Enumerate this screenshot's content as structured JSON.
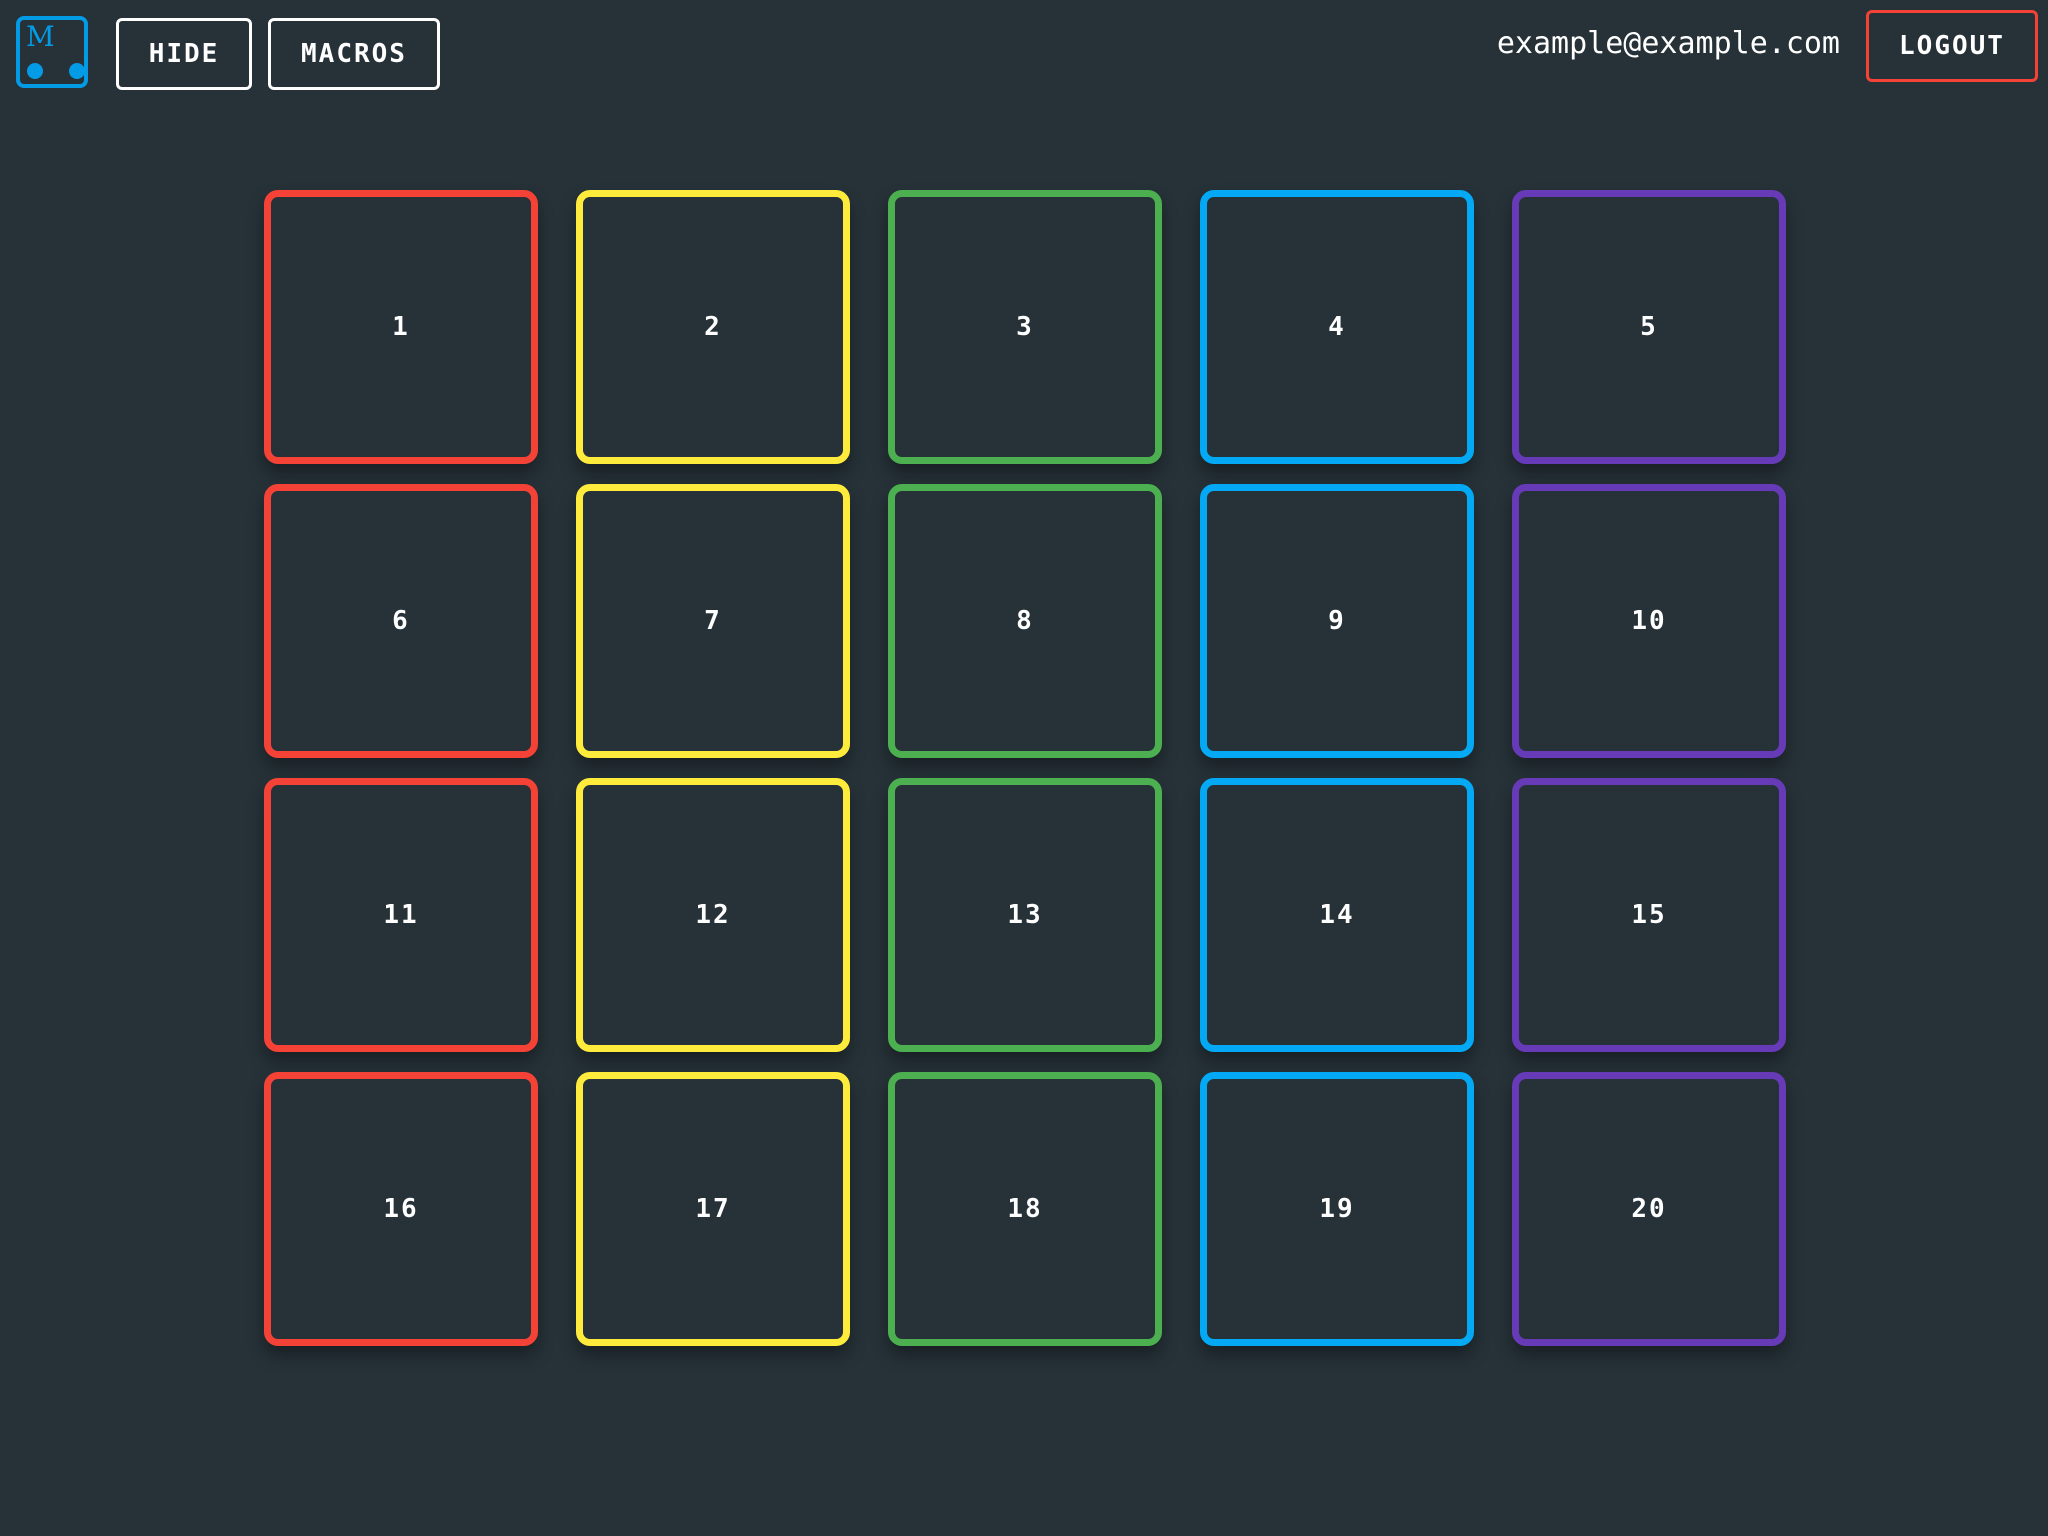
{
  "header": {
    "logo_letter": "M",
    "hide_label": "HIDE",
    "macros_label": "MACROS",
    "email": "example@example.com",
    "logout_label": "LOGOUT"
  },
  "colors": {
    "background": "#263238",
    "logo": "#039be5",
    "logout_border": "#f44336",
    "columns": [
      "#f44336",
      "#ffeb3b",
      "#4caf50",
      "#03a9f4",
      "#673ab7"
    ]
  },
  "pads": [
    {
      "label": "1",
      "color": "#f44336"
    },
    {
      "label": "2",
      "color": "#ffeb3b"
    },
    {
      "label": "3",
      "color": "#4caf50"
    },
    {
      "label": "4",
      "color": "#03a9f4"
    },
    {
      "label": "5",
      "color": "#673ab7"
    },
    {
      "label": "6",
      "color": "#f44336"
    },
    {
      "label": "7",
      "color": "#ffeb3b"
    },
    {
      "label": "8",
      "color": "#4caf50"
    },
    {
      "label": "9",
      "color": "#03a9f4"
    },
    {
      "label": "10",
      "color": "#673ab7"
    },
    {
      "label": "11",
      "color": "#f44336"
    },
    {
      "label": "12",
      "color": "#ffeb3b"
    },
    {
      "label": "13",
      "color": "#4caf50"
    },
    {
      "label": "14",
      "color": "#03a9f4"
    },
    {
      "label": "15",
      "color": "#673ab7"
    },
    {
      "label": "16",
      "color": "#f44336"
    },
    {
      "label": "17",
      "color": "#ffeb3b"
    },
    {
      "label": "18",
      "color": "#4caf50"
    },
    {
      "label": "19",
      "color": "#03a9f4"
    },
    {
      "label": "20",
      "color": "#673ab7"
    }
  ]
}
